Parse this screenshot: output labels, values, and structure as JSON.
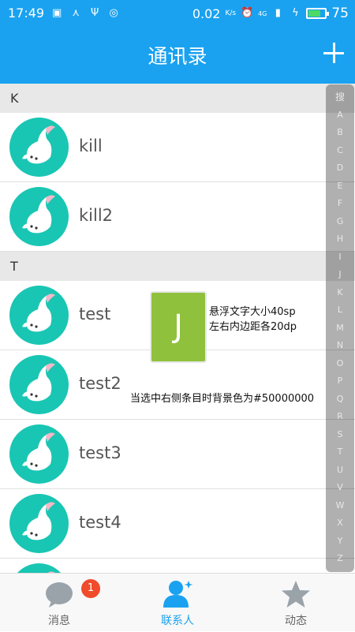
{
  "status_bar": {
    "time": "17:49",
    "net_speed": "0.02",
    "net_unit": "K/s",
    "signal_label": "4G",
    "battery_percent": "75",
    "battery_level": 0.75,
    "icons": [
      "image-icon",
      "usb-icon",
      "share-icon",
      "radar-icon",
      "alarm-icon",
      "signal-icon",
      "charging-icon",
      "battery-icon"
    ]
  },
  "header": {
    "title": "通讯录",
    "add_icon": "plus-icon"
  },
  "contacts": {
    "sections": [
      {
        "letter": "K",
        "items": [
          {
            "name": "kill"
          },
          {
            "name": "kill2"
          }
        ]
      },
      {
        "letter": "T",
        "items": [
          {
            "name": "test"
          },
          {
            "name": "test2"
          },
          {
            "name": "test3"
          },
          {
            "name": "test4"
          }
        ]
      }
    ]
  },
  "index_bar": {
    "letters": [
      "搜",
      "A",
      "B",
      "C",
      "D",
      "E",
      "F",
      "G",
      "H",
      "I",
      "J",
      "K",
      "L",
      "M",
      "N",
      "O",
      "P",
      "Q",
      "R",
      "S",
      "T",
      "U",
      "V",
      "W",
      "X",
      "Y",
      "Z"
    ]
  },
  "floating_letter": "J",
  "annotations": {
    "float_note_line1": "悬浮文字大小40sp",
    "float_note_line2": "左右内边距各20dp",
    "index_note": "当选中右侧条目时背景色为#50000000"
  },
  "bottom_nav": {
    "items": [
      {
        "label": "消息",
        "icon": "chat-bubble-icon",
        "badge": "1"
      },
      {
        "label": "联系人",
        "icon": "contacts-icon"
      },
      {
        "label": "动态",
        "icon": "star-icon"
      }
    ]
  },
  "colors": {
    "primary": "#1aa2f0",
    "avatar_bg": "#19c6b3",
    "float_bg": "#8fc13d",
    "badge": "#f04b2b"
  }
}
